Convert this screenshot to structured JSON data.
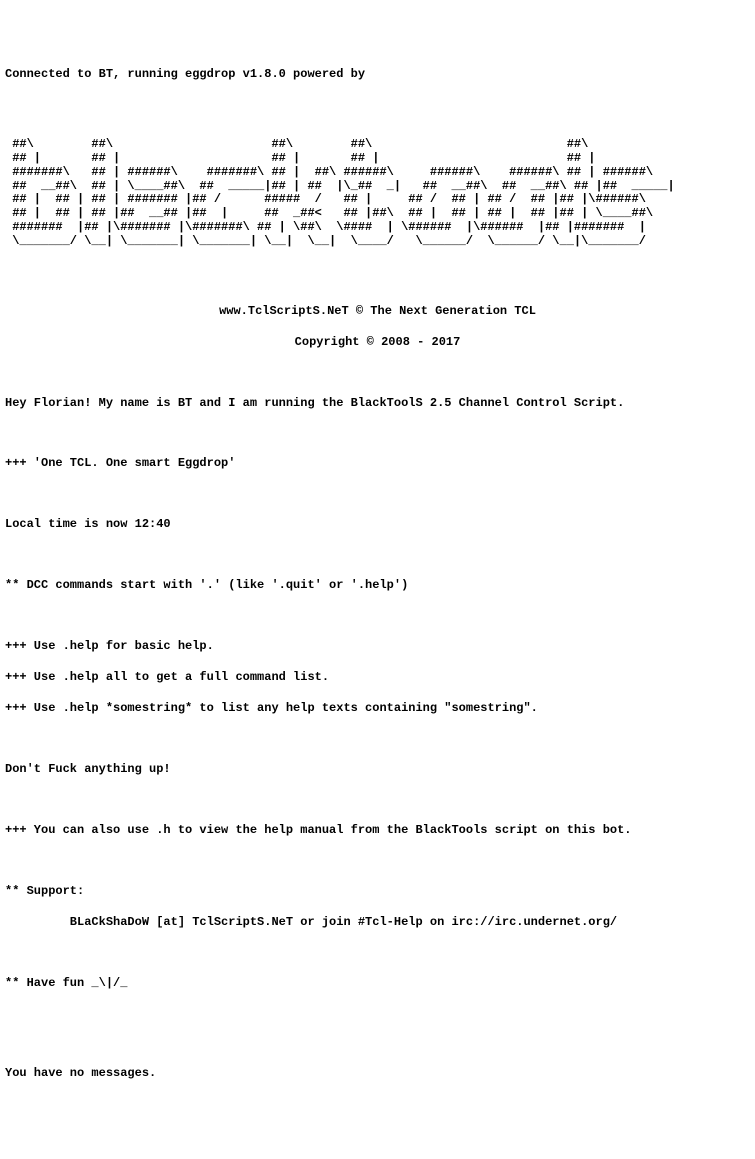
{
  "header": {
    "connected": "Connected to BT, running eggdrop v1.8.0 powered by"
  },
  "ascii_art": " ##\\        ##\\                      ##\\        ##\\                           ##\\        \n ## |       ## |                     ## |       ## |                          ## |       \n #######\\   ## | ######\\    #######\\ ## |  ##\\ ######\\     ######\\    ######\\ ## | ######\\ \n ##  __##\\  ## | \\____##\\  ##  _____|## | ##  |\\_##  _|   ##  __##\\  ##  __##\\ ## |##  _____|\n ## |  ## | ## | ####### |## /      #####  /   ## |     ## /  ## | ## /  ## |## |\\######\\ \n ## |  ## | ## |##  __## |##  |     ##  _##<   ## |##\\  ## |  ## | ## |  ## |## | \\____##\\ \n #######  |## |\\####### |\\#######\\ ## | \\##\\  \\####  | \\######  |\\######  |## |#######  |\n \\_______/ \\__| \\_______| \\_______| \\__|  \\__|  \\____/   \\______/  \\______/ \\__|\\_______/",
  "site": {
    "url_line": "www.TclScriptS.NeT © The Next Generation TCL",
    "copyright": "Copyright © 2008 - 2017"
  },
  "intro": {
    "greeting": "Hey Florian! My name is BT and I am running the BlackToolS 2.5 Channel Control Script.",
    "tagline": "+++ 'One TCL. One smart Eggdrop'",
    "localtime": "Local time is now 12:40"
  },
  "help": {
    "dcc": "** DCC commands start with '.' (like '.quit' or '.help')",
    "h1": "+++ Use .help for basic help.",
    "h2": "+++ Use .help all to get a full command list.",
    "h3": "+++ Use .help *somestring* to list any help texts containing \"somestring\"."
  },
  "warning": "Don't Fuck anything up!",
  "manual": "+++ You can also use .h to view the help manual from the BlackTools script on this bot.",
  "support": {
    "label": "** Support:",
    "detail": "         BLaCkShaDoW [at] TclScriptS.NeT or join #Tcl-Help on irc://irc.undernet.org/"
  },
  "fun": "** Have fun _\\|/_",
  "messages": "You have no messages."
}
